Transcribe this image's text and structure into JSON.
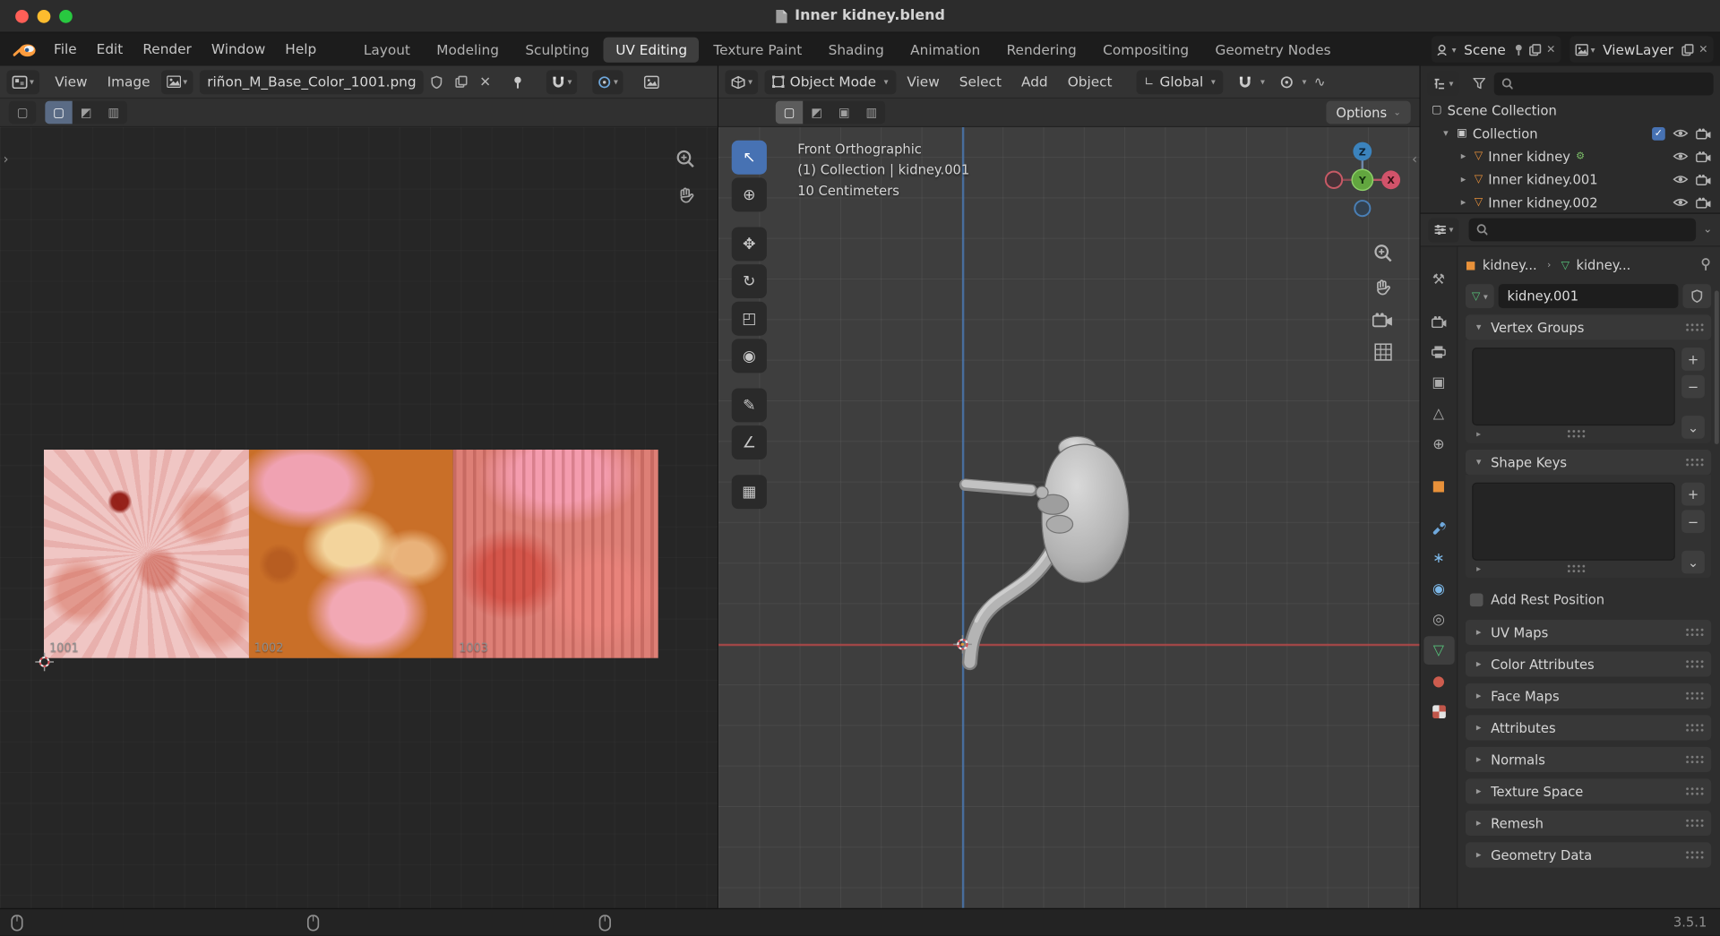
{
  "window": {
    "title": "Inner kidney.blend"
  },
  "menubar": {
    "menus": [
      "File",
      "Edit",
      "Render",
      "Window",
      "Help"
    ],
    "workspaces": [
      "Layout",
      "Modeling",
      "Sculpting",
      "UV Editing",
      "Texture Paint",
      "Shading",
      "Animation",
      "Rendering",
      "Compositing",
      "Geometry Nodes"
    ],
    "active_workspace": "UV Editing",
    "scene": "Scene",
    "view_layer": "ViewLayer"
  },
  "uv": {
    "menus": [
      "View",
      "Image"
    ],
    "image_name": "riñon_M_Base_Color_1001.png",
    "tiles": [
      "1001",
      "1002",
      "1003"
    ]
  },
  "viewport": {
    "mode": "Object Mode",
    "menus": [
      "View",
      "Select",
      "Add",
      "Object"
    ],
    "orientation": "Global",
    "options": "Options",
    "overlay": [
      "Front Orthographic",
      "(1) Collection | kidney.001",
      "10 Centimeters"
    ],
    "axes": {
      "x": "X",
      "y": "Y",
      "z": "Z"
    }
  },
  "outliner": {
    "root": "Scene Collection",
    "collection": "Collection",
    "objects": [
      "Inner kidney",
      "Inner kidney.001",
      "Inner kidney.002"
    ]
  },
  "properties": {
    "breadcrumb_object": "kidney...",
    "breadcrumb_data": "kidney...",
    "data_name": "kidney.001",
    "vertex_groups": "Vertex Groups",
    "shape_keys": "Shape Keys",
    "add_rest_position": "Add Rest Position",
    "collapsed": [
      "UV Maps",
      "Color Attributes",
      "Face Maps",
      "Attributes",
      "Normals",
      "Texture Space",
      "Remesh",
      "Geometry Data"
    ]
  },
  "statusbar": {
    "version": "3.5.1"
  },
  "icons": {
    "dropdown": "▾",
    "chevron_down": "⌄",
    "expand_right": "›",
    "collapse_left": "‹",
    "close": "✕",
    "open": "▾",
    "closed": "▸",
    "plus": "+",
    "minus": "−",
    "tweak": "↖",
    "cursor": "⊕",
    "move": "✥",
    "rotate": "↻",
    "scale": "◰",
    "transform": "◉",
    "annotate": "✎",
    "measure": "∠",
    "add_cube": "▦",
    "wave": "∿",
    "check": "✓",
    "sep": "›",
    "angle": "∟",
    "square_empty": "▢",
    "square_half": "◩",
    "square_full": "▣",
    "square_grid": "▥",
    "tool_tab": "⚒",
    "output_tab": "▤",
    "viewlayer_tab": "▣",
    "scene_tab": "△",
    "world_tab": "⊕",
    "object_tab": "■",
    "particles_tab": "∗",
    "physics_tab": "◉",
    "constraints_tab": "◎",
    "data_tab": "▽",
    "material_tab": "●",
    "modifier": "⚙"
  },
  "colors": {
    "accent_blue": "#4772b3",
    "object_orange": "#e8913a",
    "mesh_green": "#55c179",
    "axis_red": "#b04848",
    "axis_blue": "#4a78b3"
  }
}
